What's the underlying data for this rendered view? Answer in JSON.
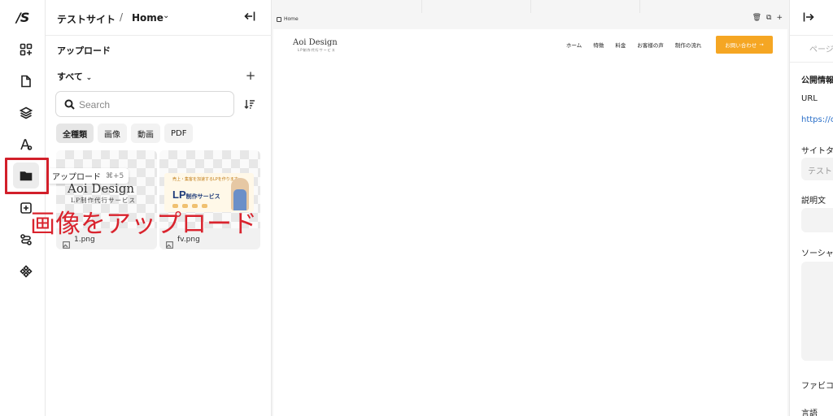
{
  "rail": {
    "logo": "/S",
    "items": [
      {
        "name": "add-element",
        "icon": "grid-plus-icon"
      },
      {
        "name": "pages",
        "icon": "document-icon"
      },
      {
        "name": "layers",
        "icon": "layers-icon"
      },
      {
        "name": "typography",
        "icon": "font-icon"
      },
      {
        "name": "assets",
        "icon": "folder-icon",
        "active": true
      },
      {
        "name": "components",
        "icon": "component-icon"
      },
      {
        "name": "logic",
        "icon": "flow-icon"
      },
      {
        "name": "plugins",
        "icon": "diamond-grid-icon"
      }
    ]
  },
  "panel": {
    "site_name": "テストサイト",
    "separator": "/",
    "page_name": "Home",
    "section_title": "アップロード",
    "filter_label": "すべて",
    "add_symbol": "+",
    "search_placeholder": "Search",
    "chips": [
      "全種類",
      "画像",
      "動画",
      "PDF"
    ],
    "files": [
      {
        "name": "1.png",
        "preview_title": "Aoi Design",
        "preview_sub": "LP制作代行サービス"
      },
      {
        "name": "fv.png",
        "preview_top": "売上・集客を加速するLPを作ります",
        "preview_title": "LP",
        "preview_title_suffix": "制作サービス"
      }
    ]
  },
  "tooltip": {
    "label": "アップロード",
    "shortcut": "⌘+5"
  },
  "annotation": {
    "text": "画像をアップロード",
    "color": "#d9232d"
  },
  "canvas": {
    "page_label": "Home",
    "tools": [
      "🗑",
      "⧉",
      "+"
    ],
    "site": {
      "logo": "Aoi Design",
      "logo_sub": "LP制作代行サービス",
      "nav": [
        "ホーム",
        "特徴",
        "料金",
        "お客様の声",
        "制作の流れ"
      ],
      "cta": "お問い合わせ",
      "cta_arrow": "→",
      "cta_color": "#f5a623"
    }
  },
  "inspector": {
    "tab": "ページ",
    "sections": [
      {
        "label": "公開情報",
        "bold": true
      },
      {
        "label": "URL"
      },
      {
        "label": "https://c",
        "link": true
      },
      {
        "label": "サイトタイ"
      },
      {
        "placeholder": "テスト"
      },
      {
        "label": "説明文"
      },
      {
        "label": "ソーシャル"
      },
      {
        "label": "ファビコ"
      },
      {
        "label": "言語"
      }
    ]
  },
  "colors": {
    "accent": "#f5a623",
    "annotation_red": "#d21f2a",
    "link": "#2a6fc9"
  }
}
